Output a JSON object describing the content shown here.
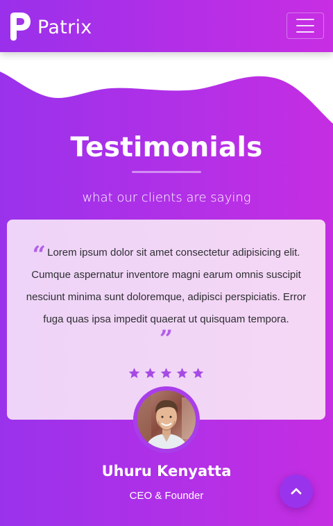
{
  "header": {
    "brand_name": "Patrix",
    "logo_icon": "p-letter-logo",
    "menu_icon": "hamburger-menu-icon"
  },
  "section": {
    "title": "Testimonials",
    "subtitle": "what our clients are saying"
  },
  "testimonial": {
    "quote": "Lorem ipsum dolor sit amet consectetur adipisicing elit. Cumque aspernatur inventore magni earum omnis suscipit nesciunt minima sunt doloremque, adipisci perspiciatis. Error fuga quas ipsa impedit quaerat ut quisquam tempora.",
    "open_quote_glyph": "“",
    "close_quote_glyph": "”",
    "rating": 5,
    "rating_max": 5,
    "author_name": "Uhuru Kenyatta",
    "author_role": "CEO & Founder"
  },
  "colors": {
    "gradient_start": "#9a32ec",
    "gradient_end": "#c52ee2",
    "card_background": "#f0d5f7",
    "accent": "#b15fe8",
    "star": "#a64ae6",
    "text_dark": "#2f2f33"
  },
  "back_to_top": {
    "icon": "chevron-up-icon"
  }
}
